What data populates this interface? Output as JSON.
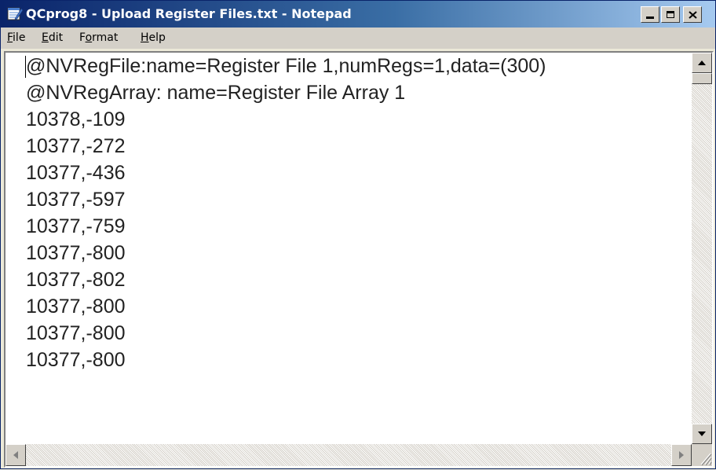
{
  "window": {
    "title": "QCprog8 - Upload Register Files.txt - Notepad",
    "icon": "notepad-icon"
  },
  "caption_buttons": {
    "minimize": "_",
    "maximize": "□",
    "close": "×"
  },
  "menu": [
    {
      "label": "File",
      "mnemonic": "F",
      "rest": "ile"
    },
    {
      "label": "Edit",
      "mnemonic": "E",
      "rest": "dit"
    },
    {
      "label": "Format",
      "prefix": "F",
      "mnemonic": "o",
      "rest": "rmat"
    },
    {
      "label": "Help",
      "mnemonic": "H",
      "rest": "elp"
    }
  ],
  "document": {
    "lines": [
      "@NVRegFile:name=Register File 1,numRegs=1,data=(300)",
      "@NVRegArray: name=Register File Array 1",
      "10378,-109",
      "10377,-272",
      "10377,-436",
      "10377,-597",
      "10377,-759",
      "10377,-800",
      "10377,-802",
      "10377,-800",
      "10377,-800",
      "10377,-800"
    ]
  },
  "colors": {
    "title_active_start": "#0a246a",
    "title_active_end": "#a6caf0",
    "face": "#d4d0c8"
  }
}
